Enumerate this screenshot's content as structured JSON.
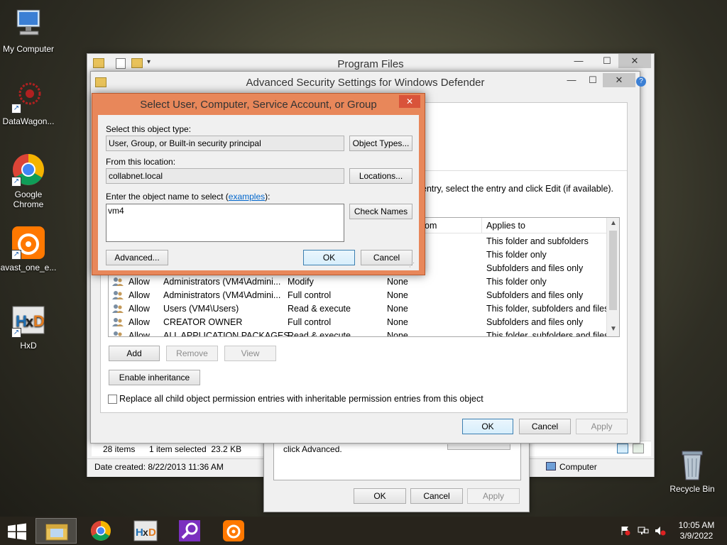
{
  "desktop": {
    "icons": [
      {
        "label": "My Computer"
      },
      {
        "label": "DataWagon..."
      },
      {
        "label": "Google Chrome"
      },
      {
        "label": "avast_one_e..."
      },
      {
        "label": "HxD"
      },
      {
        "label": "Recycle Bin"
      }
    ]
  },
  "explorer": {
    "title": "Program Files",
    "status_items": "28 items",
    "status_selected": "1 item selected  23.2 KB",
    "date_created": "Date created: 8/22/2013 11:36 AM",
    "computer_label": "Computer"
  },
  "properties": {
    "advanced_hint": "click Advanced.",
    "ok": "OK",
    "cancel": "Cancel",
    "apply": "Apply"
  },
  "advanced": {
    "title": "Advanced Security Settings for Windows Defender",
    "hint_text": "entry, select the entry and click Edit (if available).",
    "columns": {
      "inherited": "om",
      "applies": "Applies to"
    },
    "rows": [
      {
        "type": "",
        "principal": "",
        "access": "",
        "inherited": "",
        "applies": "This folder and subfolders"
      },
      {
        "type": "",
        "principal": "",
        "access": "",
        "inherited": "",
        "applies": "This folder only"
      },
      {
        "type": "",
        "principal": "",
        "access": "",
        "inherited": "",
        "applies": "Subfolders and files only"
      },
      {
        "type": "Allow",
        "principal": "Administrators (VM4\\Admini...",
        "access": "Modify",
        "inherited": "None",
        "applies": "This folder only"
      },
      {
        "type": "Allow",
        "principal": "Administrators (VM4\\Admini...",
        "access": "Full control",
        "inherited": "None",
        "applies": "Subfolders and files only"
      },
      {
        "type": "Allow",
        "principal": "Users (VM4\\Users)",
        "access": "Read & execute",
        "inherited": "None",
        "applies": "This folder, subfolders and files"
      },
      {
        "type": "Allow",
        "principal": "CREATOR OWNER",
        "access": "Full control",
        "inherited": "None",
        "applies": "Subfolders and files only"
      },
      {
        "type": "Allow",
        "principal": "ALL APPLICATION PACKAGES",
        "access": "Read & execute",
        "inherited": "None",
        "applies": "This folder, subfolders and files"
      }
    ],
    "add": "Add",
    "remove": "Remove",
    "view": "View",
    "enable_inheritance": "Enable inheritance",
    "replace_label": "Replace all child object permission entries with inheritable permission entries from this object",
    "ok": "OK",
    "cancel": "Cancel",
    "apply": "Apply"
  },
  "select_dialog": {
    "title": "Select User, Computer, Service Account, or Group",
    "object_type_label": "Select this object type:",
    "object_type_value": "User, Group, or Built-in security principal",
    "object_types_btn": "Object Types...",
    "location_label": "From this location:",
    "location_value": "collabnet.local",
    "locations_btn": "Locations...",
    "name_label_prefix": "Enter the object name to select (",
    "name_label_link": "examples",
    "name_label_suffix": "):",
    "name_value": "vm4",
    "check_names_btn": "Check Names",
    "advanced_btn": "Advanced...",
    "ok": "OK",
    "cancel": "Cancel"
  },
  "taskbar": {
    "time": "10:05 AM",
    "date": "3/9/2022"
  },
  "colors": {
    "dialog_orange": "#e8875a",
    "link_blue": "#0066cc",
    "taskbar": "#28241c"
  }
}
